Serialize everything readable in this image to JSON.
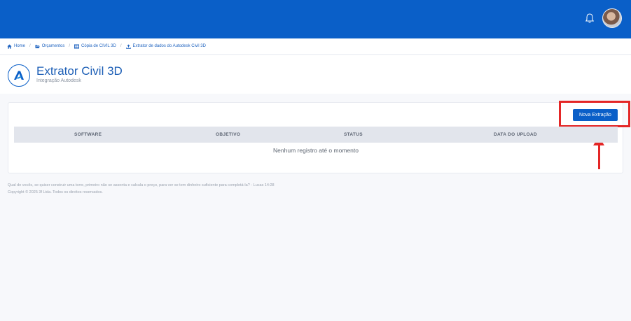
{
  "topbar": {
    "bell_icon": "bell-icon",
    "avatar_icon": "user-avatar"
  },
  "breadcrumb": [
    {
      "icon": "home-icon",
      "label": "Home"
    },
    {
      "icon": "folder-open-icon",
      "label": "Orçamentos"
    },
    {
      "icon": "table-icon",
      "label": "Cópia de CIVIL 3D"
    },
    {
      "icon": "upload-icon",
      "label": "Extrator de dados do Autodesk Civil 3D"
    }
  ],
  "page": {
    "title": "Extrator Civil 3D",
    "subtitle": "Integração Autodesk",
    "logo_icon": "autodesk-logo"
  },
  "actions": {
    "new_extraction": "Nova Extração"
  },
  "table": {
    "columns": [
      "SOFTWARE",
      "OBJETIVO",
      "STATUS",
      "DATA DO UPLOAD"
    ],
    "empty_message": "Nenhum registro até o momento"
  },
  "footer": {
    "quote": "Qual de vocês, se quiser construir uma torre, primeiro não se assenta e calcula o preço, para ver se tem dinheiro suficiente para completá-la? - Lucas 14:28",
    "copyright": "Copyright © 2025 3f Ltda. Todos os direitos reservados."
  },
  "colors": {
    "brand_blue": "#0a5fc8",
    "annotation_red": "#e42626"
  }
}
